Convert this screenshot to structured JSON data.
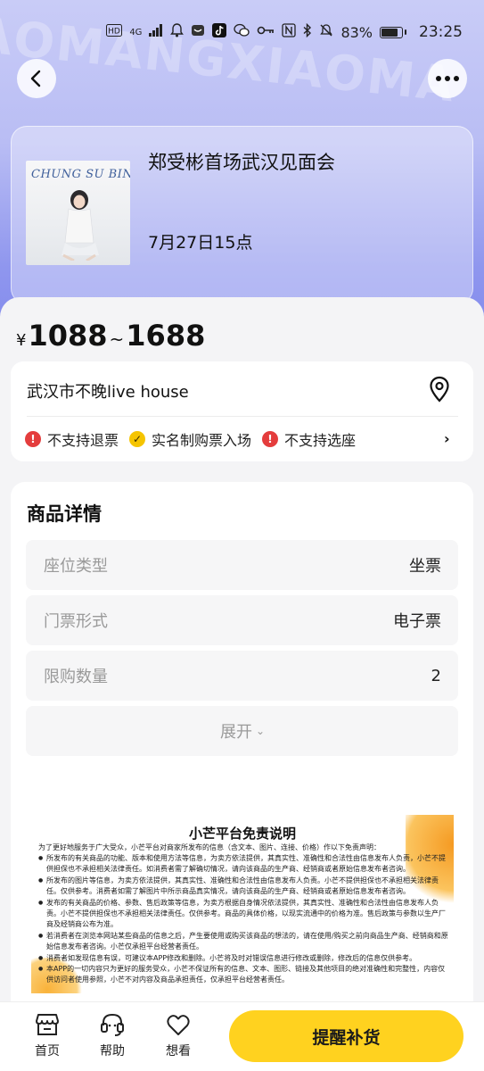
{
  "statusbar": {
    "network": "4G",
    "battery_percent": "83%",
    "battery_level": 0.83,
    "time": "23:25",
    "icons": [
      "hd-icon",
      "signal-icon",
      "bell-icon",
      "mail-icon",
      "tiktok-icon",
      "wechat-icon",
      "key-icon",
      "nfc-icon",
      "bluetooth-icon",
      "mute-icon",
      "battery-icon"
    ]
  },
  "header": {
    "watermark": "AOMANGXIAOMA",
    "back_icon": "chevron-left-icon",
    "more_icon": "more-dots-icon"
  },
  "event": {
    "title": "郑受彬首场武汉见面会",
    "date": "7月27日15点",
    "poster_title": "CHUNG SU BIN"
  },
  "price": {
    "currency": "¥",
    "min": "1088",
    "separator": "~",
    "max": "1688"
  },
  "venue": {
    "name": "武汉市不晚live house",
    "location_icon": "location-pin-icon",
    "tags": [
      {
        "label": "不支持退票",
        "type": "warning"
      },
      {
        "label": "实名制购票入场",
        "type": "check"
      },
      {
        "label": "不支持选座",
        "type": "warning"
      }
    ]
  },
  "details": {
    "title": "商品详情",
    "rows": [
      {
        "key": "座位类型",
        "value": "坐票"
      },
      {
        "key": "门票形式",
        "value": "电子票"
      },
      {
        "key": "限购数量",
        "value": "2"
      }
    ],
    "expand_label": "展开"
  },
  "disclaimer": {
    "title": "小芒平台免责说明",
    "intro": "为了更好地服务于广大受众，小芒平台对商家所发布的信息（含文本、图片、连接、价格）作以下免责声明：",
    "items": [
      "所发布的有关商品的功能、版本和使用方法等信息，为卖方依法提供，其真实性、准确性和合法性由信息发布人负责，小芒不提供担保也不承担相关法律责任。如消费者需了解确切情况，请向该商品的生产商、经销商或者原始信息发布者咨询。",
      "所发布的图片等信息，为卖方依法提供，其真实性、准确性和合法性由信息发布人负责。小芒不提供担保也不承担相关法律责任。仅供参考。消费者如需了解图片中所示商品真实情况，请向该商品的生产商、经销商或者原始信息发布者咨询。",
      "发布的有关商品的价格、参数、售后政策等信息，为卖方根据自身情况依法提供，其真实性、准确性和合法性由信息发布人负责。小芒不提供担保也不承担相关法律责任。仅供参考。商品的具体价格，以现实流通中的价格为准。售后政策与参数以生产厂商及经销商公布为准。",
      "若消费者在浏览本网站某些商品的信息之后，产生要使用或购买该商品的想法的，请在使用/购买之前向商品生产商、经销商和原始信息发布者咨询。小芒仅承担平台经营者责任。",
      "消费者如发现信息有误，可建议本APP修改和删除。小芒将及时对错误信息进行修改或删除，修改后的信息仅供参考。",
      "本APP的一切内容只为更好的服务受众，小芒不保证所有的信息、文本、图形、链接及其他项目的绝对准确性和完整性，内容仅供访问者使用参照，小芒不对内容及商品承担责任，仅承担平台经营者责任。"
    ]
  },
  "bottom_nav": {
    "items": [
      {
        "label": "首页",
        "icon": "shop-icon"
      },
      {
        "label": "帮助",
        "icon": "headset-icon"
      },
      {
        "label": "想看",
        "icon": "heart-icon"
      }
    ],
    "cta_label": "提醒补货"
  },
  "colors": {
    "accent_yellow": "#ffd21f",
    "warning_red": "#e43d3d",
    "check_yellow": "#f5c400",
    "header_gradient_top": "#c9ccf7",
    "header_gradient_bottom": "#7f88ec"
  }
}
